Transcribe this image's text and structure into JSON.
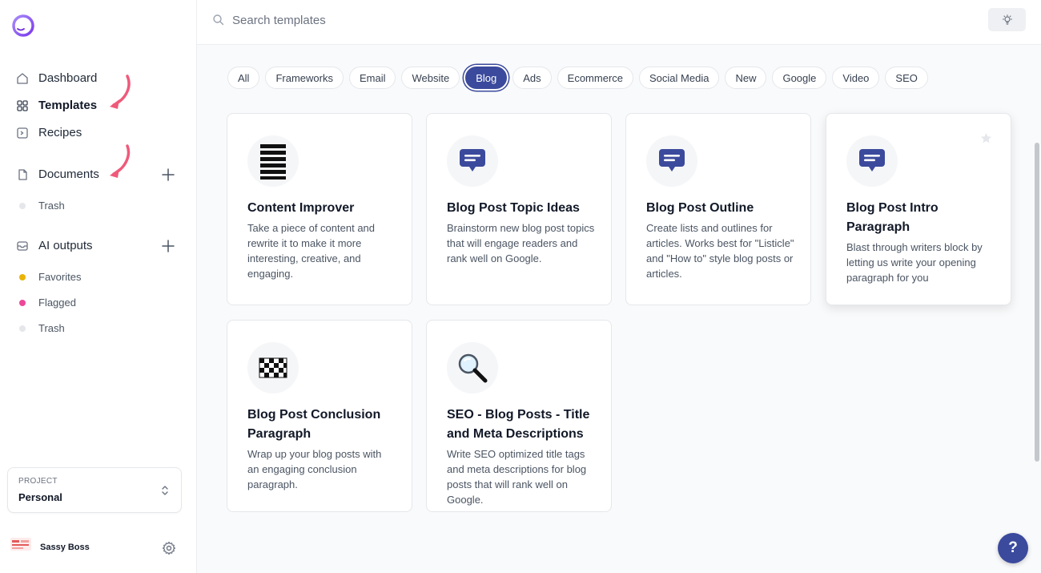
{
  "sidebar": {
    "nav": [
      {
        "label": "Dashboard",
        "icon": "home-icon"
      },
      {
        "label": "Templates",
        "icon": "grid-icon",
        "active": true
      },
      {
        "label": "Recipes",
        "icon": "terminal-icon"
      }
    ],
    "documents": {
      "label": "Documents",
      "icon": "document-icon",
      "trash": "Trash"
    },
    "ai_outputs": {
      "label": "AI outputs",
      "icon": "inbox-icon",
      "items": [
        {
          "label": "Favorites",
          "color": "#eab308"
        },
        {
          "label": "Flagged",
          "color": "#ec4899"
        },
        {
          "label": "Trash",
          "color": "#d1d5db"
        }
      ]
    },
    "project": {
      "label": "PROJECT",
      "value": "Personal"
    },
    "user": {
      "name": "Sassy Boss"
    }
  },
  "search": {
    "placeholder": "Search templates"
  },
  "filters": [
    {
      "label": "All"
    },
    {
      "label": "Frameworks"
    },
    {
      "label": "Email"
    },
    {
      "label": "Website"
    },
    {
      "label": "Blog",
      "active": true
    },
    {
      "label": "Ads"
    },
    {
      "label": "Ecommerce"
    },
    {
      "label": "Social Media"
    },
    {
      "label": "New"
    },
    {
      "label": "Google"
    },
    {
      "label": "Video"
    },
    {
      "label": "SEO"
    }
  ],
  "cards": [
    {
      "title": "Content Improver",
      "desc": "Take a piece of content and rewrite it to make it more interesting, creative, and engaging.",
      "icon": "stacked-bars-icon"
    },
    {
      "title": "Blog Post Topic Ideas",
      "desc": "Brainstorm new blog post topics that will engage readers and rank well on Google.",
      "icon": "chat-bubble-icon"
    },
    {
      "title": "Blog Post Outline",
      "desc": "Create lists and outlines for articles. Works best for \"Listicle\" and \"How to\" style blog posts or articles.",
      "icon": "chat-bubble-icon"
    },
    {
      "title": "Blog Post Intro Paragraph",
      "desc": "Blast through writers block by letting us write your opening paragraph for you",
      "icon": "chat-bubble-icon"
    },
    {
      "title": "Blog Post Conclusion Paragraph",
      "desc": "Wrap up your blog posts with an engaging conclusion paragraph.",
      "icon": "checkered-flag-icon"
    },
    {
      "title": "SEO - Blog Posts - Title and Meta Descriptions",
      "desc": "Write SEO optimized title tags and meta descriptions for blog posts that will rank well on Google.",
      "icon": "magnifying-glass-icon"
    }
  ],
  "help": {
    "label": "?"
  },
  "colors": {
    "accent": "#3b4a9c",
    "arrow": "#ef5a7a"
  }
}
